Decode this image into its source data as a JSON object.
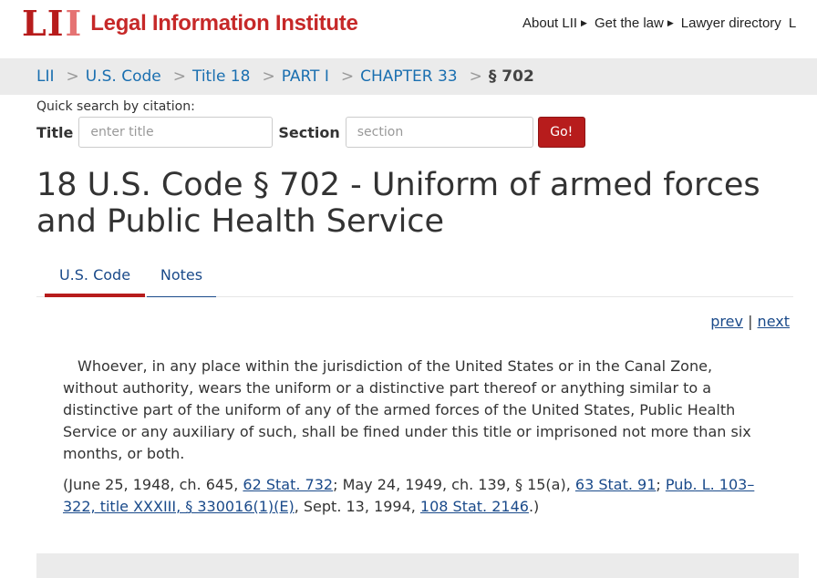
{
  "header": {
    "logo_mark": [
      "L",
      "I",
      "I"
    ],
    "logo_text": "Legal Information Institute",
    "nav": [
      {
        "label": "About LII"
      },
      {
        "label": "Get the law"
      },
      {
        "label": "Lawyer directory"
      },
      {
        "label": "L"
      }
    ]
  },
  "breadcrumb": {
    "items": [
      "LII",
      "U.S. Code",
      "Title 18",
      "PART I",
      "CHAPTER 33"
    ],
    "separator": ">",
    "current": "§ 702"
  },
  "quick_search": {
    "label": "Quick search by citation:",
    "title_label": "Title",
    "title_placeholder": "enter title",
    "section_label": "Section",
    "section_placeholder": "section",
    "go_label": "Go!"
  },
  "page": {
    "title": "18 U.S. Code § 702 - Uniform of armed forces and Public Health Service",
    "tabs": [
      {
        "label": "U.S. Code",
        "active": true
      },
      {
        "label": "Notes",
        "active": false
      }
    ],
    "prev_label": "prev",
    "next_label": "next",
    "pn_separator": "|",
    "statute_text": "Whoever, in any place within the jurisdiction of the United States or in the Canal Zone, without authority, wears the uniform or a distinctive part thereof or anything similar to a distinctive part of the uniform of any of the armed forces of the United States, Public Health Service or any auxiliary of such, shall be fined under this title or imprisoned not more than six months, or both.",
    "credits": {
      "t1": "(June 25, 1948, ch. 645, ",
      "l1": "62 Stat. 732",
      "t2": "; May 24, 1949, ch. 139, § 15(a), ",
      "l2": "63 Stat. 91",
      "t3": "; ",
      "l3": "Pub. L. 103–322, title XXXIII, § 330016(1)(E)",
      "t4": ", Sept. 13, 1994, ",
      "l4": "108 Stat. 2146",
      "t5": ".)"
    }
  },
  "colors": {
    "brand_red": "#b71c1c",
    "link_blue": "#1a4a8a",
    "crumb_blue": "#1a6fb0",
    "bar_gray": "#ebebeb"
  }
}
